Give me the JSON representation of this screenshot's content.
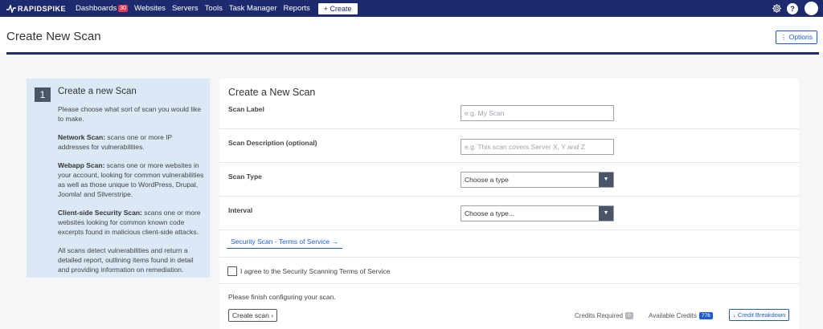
{
  "nav": {
    "logo_text": "RAPIDSPIKE",
    "items": [
      {
        "label": "Dashboards",
        "badge": "30"
      },
      {
        "label": "Websites"
      },
      {
        "label": "Servers"
      },
      {
        "label": "Tools"
      },
      {
        "label": "Task Manager"
      },
      {
        "label": "Reports"
      }
    ],
    "create_label": "+ Create",
    "help_label": "?",
    "icons": [
      "settings-icon",
      "help-icon",
      "avatar"
    ]
  },
  "page": {
    "title": "Create New Scan",
    "options_label": "⋮ Options"
  },
  "info": {
    "step": "1",
    "title": "Create a new Scan",
    "intro": "Please choose what sort of scan you would like to make.",
    "network_title": "Network Scan:",
    "network_text": " scans one or more IP addresses for vulnerabilities.",
    "webapp_title": "Webapp Scan:",
    "webapp_text": " scans one or more websites in your account, looking for common vulnerabilities as well as those unique to WordPress, Drupal, Joomla! and Silverstripe.",
    "client_title": "Client-side Security Scan:",
    "client_text": " scans one or more websites looking for common known code excerpts found in malicious client-side attacks.",
    "outro": "All scans detect vulnerabilities and return a detailed report, outlining items found in detail and providing information on remediation."
  },
  "form": {
    "title": "Create a New Scan",
    "label_label": "Scan Label",
    "label_placeholder": "e.g. My Scan",
    "desc_label": "Scan Description (optional)",
    "desc_placeholder": "e.g. This scan covers Server X, Y and Z",
    "type_label": "Scan Type",
    "type_value": "Choose a type",
    "interval_label": "Interval",
    "interval_value": "Choose a type...",
    "tos_link": "Security Scan - Terms of Service →",
    "agree_label": "I agree to the Security Scanning Terms of Service",
    "hint": "Please finish configuring your scan.",
    "create_label": "Create scan ›",
    "credits_required_label": "Credits Required",
    "credits_required_value": "0",
    "available_credits_label": "Available Credits",
    "available_credits_value": "776",
    "breakdown_label": "↓ Credit Breakdown"
  },
  "colors": {
    "nav_bg": "#1d2a6d",
    "accent": "#1d5bd6",
    "badge": "#e23b56",
    "info_bg": "#dbe8f6"
  }
}
